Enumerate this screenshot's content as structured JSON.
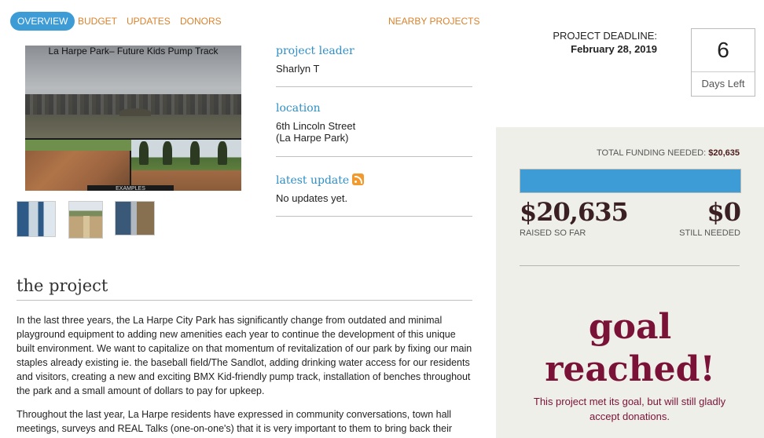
{
  "nav": {
    "tabs": [
      {
        "label": "OVERVIEW",
        "active": true
      },
      {
        "label": "BUDGET"
      },
      {
        "label": "UPDATES"
      },
      {
        "label": "DONORS"
      }
    ],
    "nearby_label": "NEARBY PROJECTS"
  },
  "gallery": {
    "hero_caption": "La Harpe Park– Future Kids Pump Track",
    "hero_overlay": "EXAMPLES"
  },
  "info": {
    "leader_label": "project leader",
    "leader_value": "Sharlyn T",
    "location_label": "location",
    "location_line1": "6th Lincoln Street",
    "location_line2": "(La Harpe Park)",
    "update_label": "latest update",
    "update_value": "No updates yet."
  },
  "project": {
    "heading": "the project",
    "paragraphs": [
      "In the last three years, the La Harpe City Park has significantly change from outdated and minimal playground equipment to adding new amenities each year to continue the development of this unique built environment. We want to capitalize on that momentum of revitalization of our park by fixing our main staples already existing ie. the baseball field/The Sandlot, adding drinking water access for our residents and visitors, creating a new and exciting BMX Kid-friendly pump track, installation of benches throughout the park and a small amount of dollars to pay for upkeep.",
      "Throughout the last year, La Harpe residents have expressed in community conversations, town hall meetings, surveys and REAL Talks (one-on-one's) that it is very important to them to bring back their"
    ]
  },
  "deadline": {
    "label": "PROJECT DEADLINE:",
    "date": "February 28, 2019",
    "days_number": "6",
    "days_label": "Days Left"
  },
  "funding": {
    "total_label": "TOTAL FUNDING NEEDED:",
    "total_value": "$20,635",
    "progress_fraction": 1.0,
    "raised_amount": "$20,635",
    "raised_label": "RAISED SO FAR",
    "needed_amount": "$0",
    "needed_label": "STILL NEEDED",
    "goal_line1": "goal",
    "goal_line2": "reached!",
    "goal_note": "This project met its goal, but will still gladly accept donations."
  },
  "colors": {
    "accent_blue": "#3d9bd6",
    "nav_orange": "#d9822b",
    "goal_maroon": "#7a1238",
    "panel_bg": "#efefea"
  }
}
